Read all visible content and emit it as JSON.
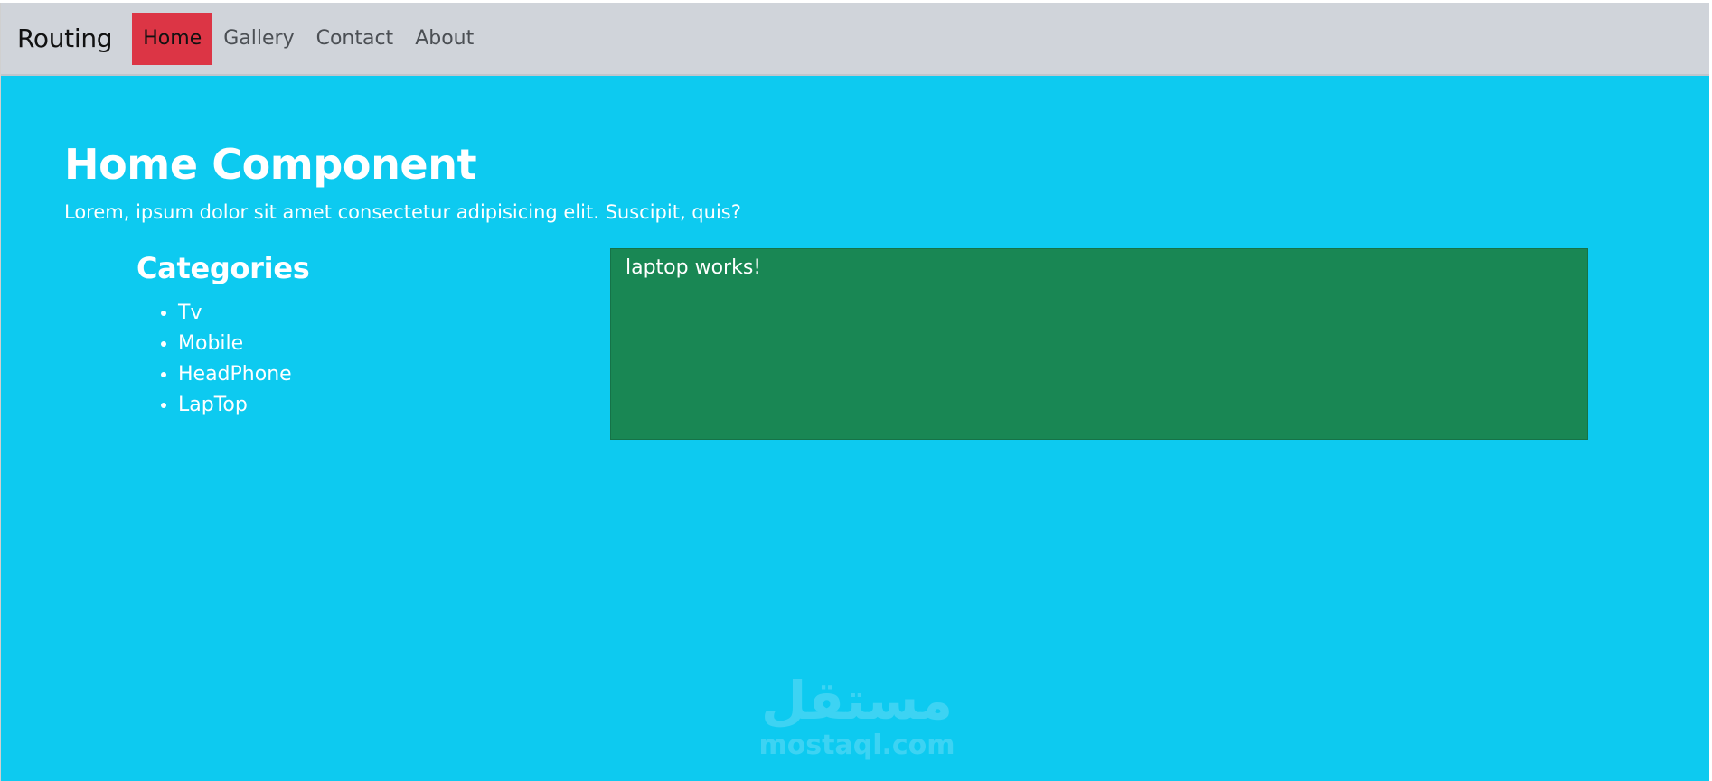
{
  "navbar": {
    "brand": "Routing",
    "links": [
      {
        "label": "Home",
        "active": true
      },
      {
        "label": "Gallery",
        "active": false
      },
      {
        "label": "Contact",
        "active": false
      },
      {
        "label": "About",
        "active": false
      }
    ],
    "active_color": "#dc3545",
    "background": "#d0d4da"
  },
  "main": {
    "title": "Home Component",
    "text": "Lorem, ipsum dolor sit amet consectetur adipisicing elit. Suscipit, quis?",
    "background": "#0dcaf0"
  },
  "categories": {
    "heading": "Categories",
    "items": [
      "Tv",
      "Mobile",
      "HeadPhone",
      "LapTop"
    ]
  },
  "outlet": {
    "text": "laptop works!",
    "background": "#198754"
  },
  "watermark": {
    "arabic": "مستقل",
    "latin": "mostaql.com"
  }
}
